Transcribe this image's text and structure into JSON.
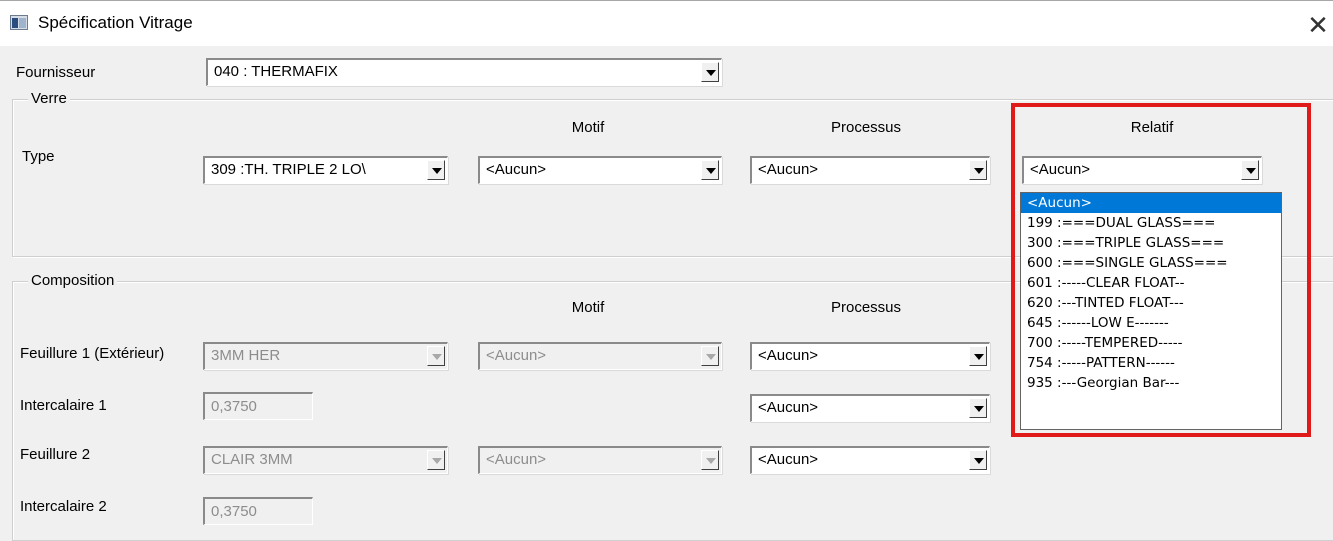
{
  "window": {
    "title": "Spécification Vitrage",
    "close_glyph": "✕"
  },
  "fournisseur": {
    "label": "Fournisseur",
    "value": "040   : THERMAFIX"
  },
  "verre": {
    "group_label": "Verre",
    "headers": {
      "motif": "Motif",
      "processus": "Processus",
      "relatif": "Relatif"
    },
    "type_label": "Type",
    "type_value": "309 :TH. TRIPLE 2 LO\\",
    "motif_value": "<Aucun>",
    "processus_value": "<Aucun>",
    "relatif_value": "<Aucun>"
  },
  "relatif_dropdown": {
    "options": [
      "<Aucun>",
      "199 :===DUAL GLASS===",
      "300 :===TRIPLE GLASS===",
      "600 :===SINGLE GLASS===",
      "601 :-----CLEAR FLOAT--",
      "620 :---TINTED FLOAT---",
      "645 :------LOW E-------",
      "700 :-----TEMPERED-----",
      "754 :-----PATTERN------",
      "935 :---Georgian Bar---"
    ],
    "selected": "<Aucun>"
  },
  "composition": {
    "group_label": "Composition",
    "headers": {
      "motif": "Motif",
      "processus": "Processus"
    },
    "feuillure1": {
      "label": "Feuillure 1 (Extérieur)",
      "value": "3MM HER",
      "motif": "<Aucun>",
      "processus": "<Aucun>"
    },
    "intercalaire1": {
      "label": "Intercalaire 1",
      "value": "0,3750",
      "processus": "<Aucun>"
    },
    "feuillure2": {
      "label": "Feuillure 2",
      "value": "CLAIR 3MM",
      "motif": "<Aucun>",
      "processus": "<Aucun>"
    },
    "intercalaire2": {
      "label": "Intercalaire 2",
      "value": "0,3750"
    }
  },
  "colors": {
    "selection": "#0078d7",
    "highlight": "#e01919"
  }
}
